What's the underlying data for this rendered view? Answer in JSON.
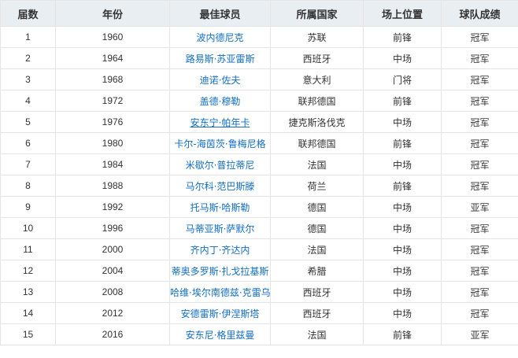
{
  "table": {
    "headers": [
      "届数",
      "年份",
      "最佳球员",
      "所属国家",
      "场上位置",
      "球队成绩"
    ],
    "rows": [
      {
        "no": "1",
        "year": "1960",
        "player": "波内德尼克",
        "country": "苏联",
        "position": "前锋",
        "result": "冠军"
      },
      {
        "no": "2",
        "year": "1964",
        "player": "路易斯·苏亚雷斯",
        "country": "西班牙",
        "position": "中场",
        "result": "冠军"
      },
      {
        "no": "3",
        "year": "1968",
        "player": "迪诺·佐夫",
        "country": "意大利",
        "position": "门将",
        "result": "冠军"
      },
      {
        "no": "4",
        "year": "1972",
        "player": "盖德·穆勒",
        "country": "联邦德国",
        "position": "前锋",
        "result": "冠军"
      },
      {
        "no": "5",
        "year": "1976",
        "player": "安东宁·帕年卡",
        "country": "捷克斯洛伐克",
        "position": "中场",
        "result": "冠军"
      },
      {
        "no": "6",
        "year": "1980",
        "player": "卡尔-海茵茨·鲁梅尼格",
        "country": "联邦德国",
        "position": "前锋",
        "result": "冠军"
      },
      {
        "no": "7",
        "year": "1984",
        "player": "米歇尔·普拉蒂尼",
        "country": "法国",
        "position": "中场",
        "result": "冠军"
      },
      {
        "no": "8",
        "year": "1988",
        "player": "马尔科·范巴斯滕",
        "country": "荷兰",
        "position": "前锋",
        "result": "冠军"
      },
      {
        "no": "9",
        "year": "1992",
        "player": "托马斯·哈斯勒",
        "country": "德国",
        "position": "中场",
        "result": "亚军"
      },
      {
        "no": "10",
        "year": "1996",
        "player": "马蒂亚斯·萨默尔",
        "country": "德国",
        "position": "中场",
        "result": "冠军"
      },
      {
        "no": "11",
        "year": "2000",
        "player": "齐内丁·齐达内",
        "country": "法国",
        "position": "中场",
        "result": "冠军"
      },
      {
        "no": "12",
        "year": "2004",
        "player": "蒂奥多罗斯·扎戈拉基斯",
        "country": "希腊",
        "position": "中场",
        "result": "冠军"
      },
      {
        "no": "13",
        "year": "2008",
        "player": "哈维·埃尔南德兹·克雷乌斯",
        "country": "西班牙",
        "position": "中场",
        "result": "冠军"
      },
      {
        "no": "14",
        "year": "2012",
        "player": "安德雷斯·伊涅斯塔",
        "country": "西班牙",
        "position": "中场",
        "result": "冠军"
      },
      {
        "no": "15",
        "year": "2016",
        "player": "安东尼·格里兹曼",
        "country": "法国",
        "position": "前锋",
        "result": "亚军"
      }
    ]
  },
  "colors": {
    "header_bg": "#e9eef2",
    "border": "#e4e4e4",
    "link": "#136ec2",
    "text": "#333333"
  }
}
